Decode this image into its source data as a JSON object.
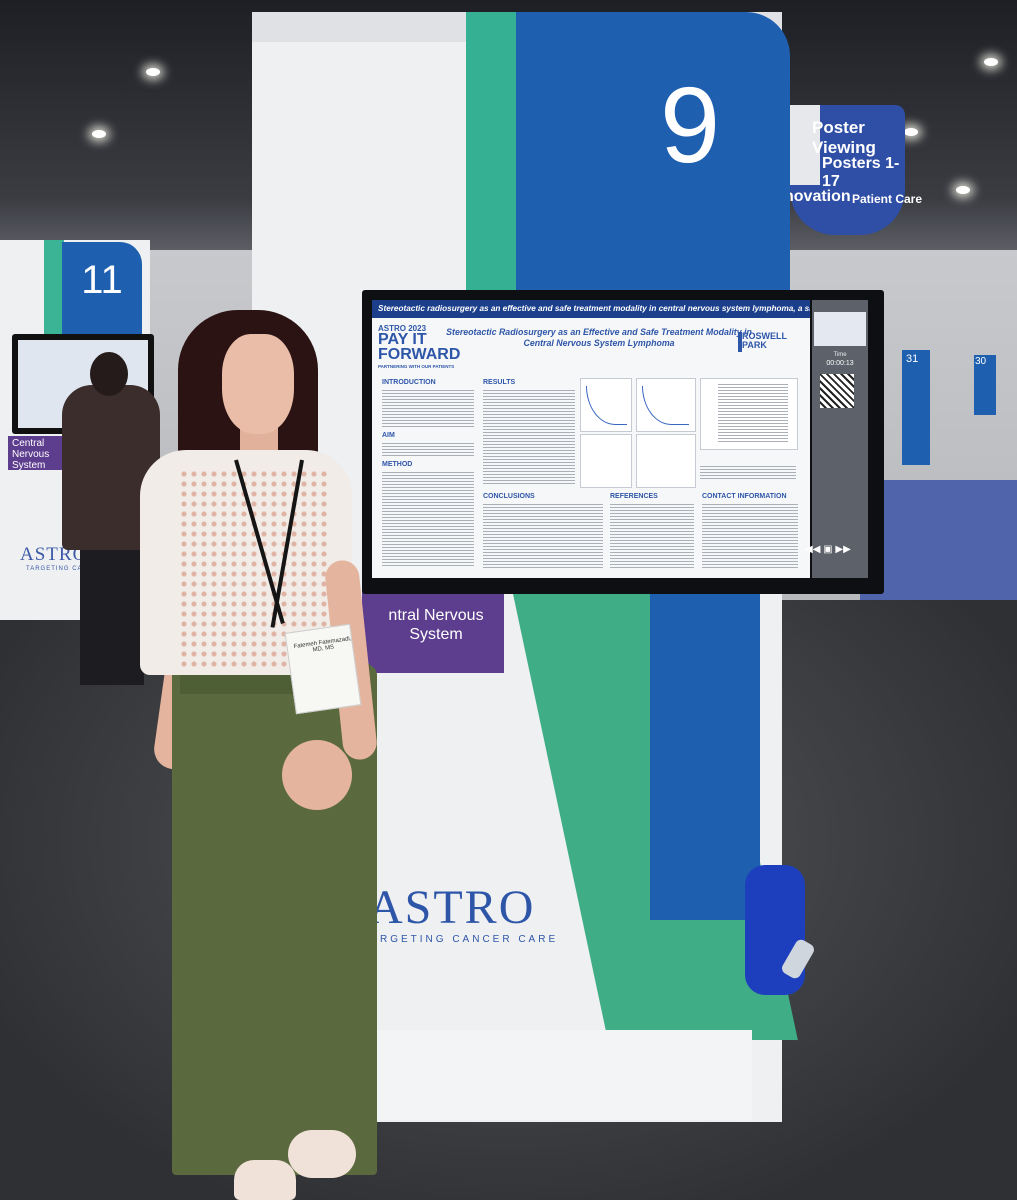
{
  "scene": {
    "kiosk_number": "9",
    "left_kiosk_number": "11",
    "left_kiosk_label": "Central Nervous System",
    "left_kiosk_brand": "ASTRO",
    "left_kiosk_brand_sub": "TARGETING CANCER CARE",
    "right_kiosk_numbers": [
      "31",
      "30"
    ],
    "hanging_sign": {
      "line1": "Poster Viewing",
      "line2": "Posters 1-17",
      "line3": "novation",
      "line4": "Patient Care"
    },
    "kiosk_category_label": "ntral Nervous System",
    "kiosk_brand": "ASTRO",
    "kiosk_brand_sub": "RGETING CANCER CARE",
    "badge_name": "Fatemeh Fatemazadi, MD, MS"
  },
  "poster": {
    "banner": "Stereotactic radiosurgery as an effective and safe treatment modality in central nervous system lymphoma, a single institution experience",
    "logo_astro": "ASTRO 2023",
    "logo_pay": "PAY IT FORWARD",
    "logo_partner": "PARTNERING WITH OUR PATIENTS",
    "title": "Stereotactic Radiosurgery as an Effective and Safe Treatment Modality in Central Nervous System Lymphoma",
    "roswell": "ROSWELL PARK",
    "sections": {
      "introduction": "INTRODUCTION",
      "aim": "AIM",
      "method": "METHOD",
      "results": "RESULTS",
      "conclusions": "CONCLUSIONS",
      "references": "REFERENCES",
      "contact": "CONTACT INFORMATION"
    },
    "side_panel": {
      "time_label": "Time",
      "time": "00:00:13"
    }
  },
  "colors": {
    "astro_blue": "#1f5fb0",
    "astro_teal": "#35b093",
    "cns_purple": "#5d3d8e"
  }
}
